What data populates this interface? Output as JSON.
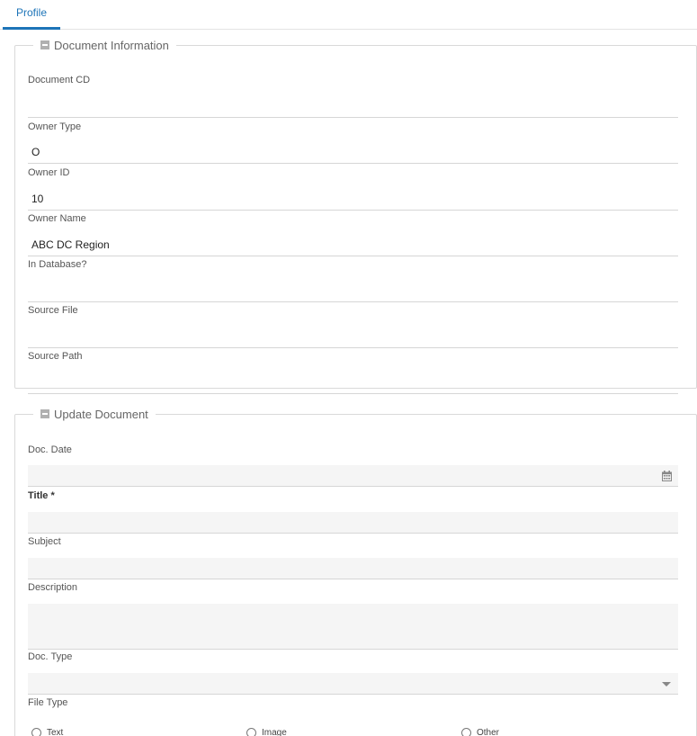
{
  "tabs": [
    {
      "label": "Profile"
    }
  ],
  "document_info": {
    "title": "Document Information",
    "fields": [
      {
        "label": "Document CD",
        "value": ""
      },
      {
        "label": "Owner Type",
        "value": "O"
      },
      {
        "label": "Owner ID",
        "value": "10"
      },
      {
        "label": "Owner Name",
        "value": "ABC DC Region"
      },
      {
        "label": "In Database?",
        "value": ""
      },
      {
        "label": "Source File",
        "value": ""
      },
      {
        "label": "Source Path",
        "value": ""
      }
    ]
  },
  "update_document": {
    "title": "Update Document",
    "doc_date": {
      "label": "Doc. Date",
      "value": ""
    },
    "title_field": {
      "label": "Title *",
      "value": ""
    },
    "subject": {
      "label": "Subject",
      "value": ""
    },
    "description": {
      "label": "Description",
      "value": ""
    },
    "doc_type": {
      "label": "Doc. Type",
      "value": ""
    },
    "file_type": {
      "label": "File Type",
      "options": [
        "Text",
        "Image",
        "Other"
      ]
    }
  },
  "icons": {
    "collapse": "minus-square-icon",
    "calendar": "calendar-icon",
    "dropdown": "caret-down-icon"
  }
}
